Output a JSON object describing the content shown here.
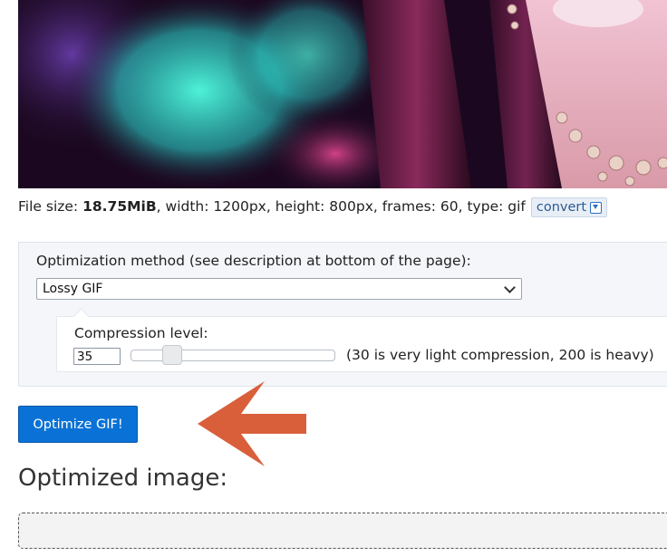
{
  "file_info": {
    "prefix": "File size:",
    "size": "18.75MiB",
    "details": ", width: 1200px, height: 800px, frames: 60, type: gif",
    "convert_label": "convert",
    "convert_icon": "download-icon"
  },
  "options": {
    "method_label": "Optimization method (see description at bottom of the page):",
    "method_value": "Lossy GIF",
    "compression_label": "Compression level:",
    "compression_value": "35",
    "compression_fraction": 0.17,
    "compression_note": "(30 is very light compression, 200 is heavy)"
  },
  "actions": {
    "optimize_label": "Optimize GIF!"
  },
  "result": {
    "title": "Optimized image:"
  },
  "colors": {
    "primary_button": "#0a72d6",
    "arrow": "#d95f3b",
    "panel_bg": "#f4f6f9"
  }
}
